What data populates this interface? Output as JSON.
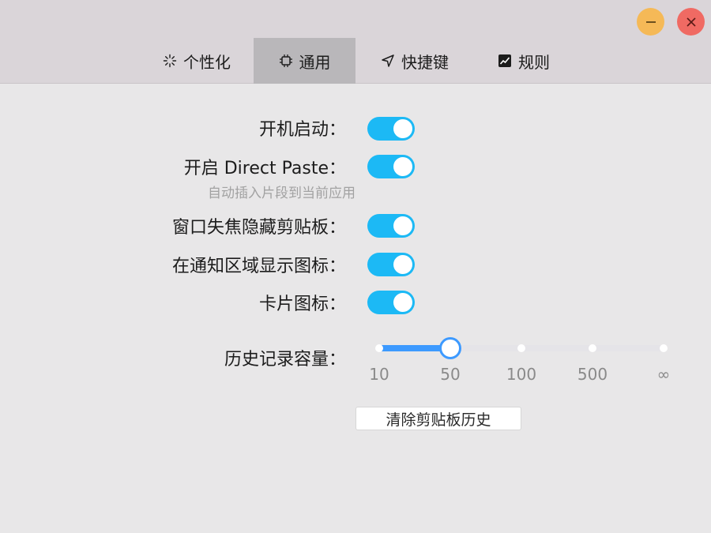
{
  "window_controls": {
    "minimize_color": "#f5b957",
    "close_color": "#f06a63"
  },
  "tabs": [
    {
      "label": "个性化",
      "icon": "sparkle-icon",
      "active": false
    },
    {
      "label": "通用",
      "icon": "chip-icon",
      "active": true
    },
    {
      "label": "快捷键",
      "icon": "navigation-arrow-icon",
      "active": false
    },
    {
      "label": "规则",
      "icon": "chart-icon",
      "active": false
    }
  ],
  "settings": {
    "autostart": {
      "label": "开机启动：",
      "enabled": true
    },
    "direct_paste": {
      "label": "开启 Direct Paste：",
      "sublabel": "自动插入片段到当前应用",
      "enabled": true
    },
    "hide_on_blur": {
      "label": "窗口失焦隐藏剪贴板：",
      "enabled": true
    },
    "tray_icon": {
      "label": "在通知区域显示图标：",
      "enabled": true
    },
    "card_icon": {
      "label": "卡片图标：",
      "enabled": true
    }
  },
  "history": {
    "label": "历史记录容量：",
    "marks": [
      "10",
      "50",
      "100",
      "500",
      "∞"
    ],
    "selected": "50"
  },
  "clear_button": {
    "label": "清除剪贴板历史"
  },
  "colors": {
    "toggle_on": "#1cb9f5",
    "slider_accent": "#3d9aff",
    "active_tab": "#b9b7ba"
  }
}
